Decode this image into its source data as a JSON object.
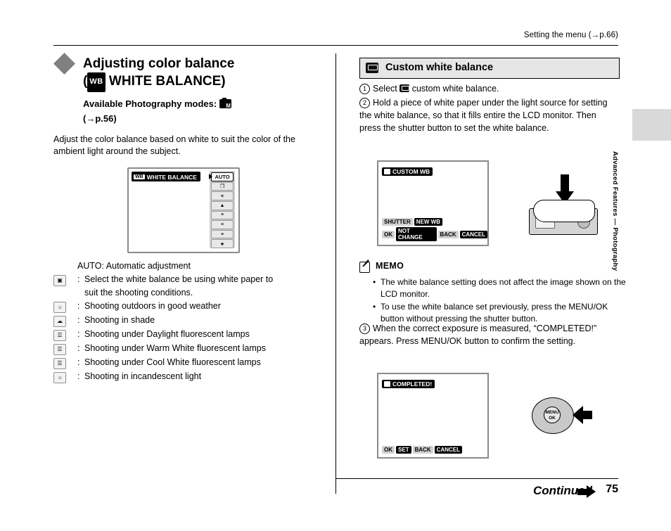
{
  "header": {
    "running_head": "Setting the menu (→p.66)"
  },
  "side_tab": {
    "label": "Advanced Features — Photography"
  },
  "left": {
    "title_line1": "Adjusting color balance",
    "title_line2_prefix": "(",
    "title_wb_chip": "WB",
    "title_line2_suffix": " WHITE BALANCE)",
    "modes_label": "Available Photography modes:",
    "modes_page": "(→p.56)",
    "intro": "Adjust the color balance based on white to suit the color of the ambient light around the subject.",
    "lcd": {
      "title": "WHITE BALANCE",
      "title_icon": "WB",
      "selected": "AUTO",
      "items": [
        "AUTO",
        "❐",
        "☀",
        "▲",
        "≡",
        "≡",
        "≡",
        "★"
      ]
    },
    "legend": [
      {
        "glyph": "",
        "label": "AUTO:",
        "text": "Automatic adjustment"
      },
      {
        "glyph": "custom-wb-icon",
        "label": ":",
        "text": "Select the white balance be using white paper to",
        "text2": "suit the shooting conditions."
      },
      {
        "glyph": "sun-icon",
        "label": ":",
        "text": "Shooting outdoors in good weather"
      },
      {
        "glyph": "shade-icon",
        "label": ":",
        "text": "Shooting in shade"
      },
      {
        "glyph": "daylight-fluorescent-icon",
        "label": ":",
        "text": "Shooting under Daylight fluorescent lamps"
      },
      {
        "glyph": "warm-white-fluorescent-icon",
        "label": ":",
        "text": "Shooting under Warm White fluorescent lamps"
      },
      {
        "glyph": "cool-white-fluorescent-icon",
        "label": ":",
        "text": "Shooting under Cool White fluorescent lamps"
      },
      {
        "glyph": "incandescent-icon",
        "label": ":",
        "text": "Shooting in incandescent light"
      }
    ]
  },
  "right": {
    "section_title": "Custom white balance",
    "steps": [
      {
        "num": "1",
        "text_before": "Select ",
        "text_after": " custom white balance."
      },
      {
        "num": "2",
        "text": "Hold a piece of white paper under the light source for setting the white balance, so that it fills entire the LCD monitor. Then press the shutter button to set the white balance."
      },
      {
        "num": "3",
        "text": "When the correct exposure is measured, “COMPLETED!” appears. Press MENU/OK button to confirm the setting."
      }
    ],
    "lcd2": {
      "title": "CUSTOM WB",
      "btn_shutter": "SHUTTER",
      "btn_shutter_action": "NEW WB",
      "btn_ok": "OK",
      "btn_ok_action": "NOT CHANGE",
      "btn_back": "BACK",
      "btn_back_action": "CANCEL"
    },
    "lcd3": {
      "title": "COMPLETED!",
      "btn_ok": "OK",
      "btn_ok_action": "SET",
      "btn_back": "BACK",
      "btn_back_action": "CANCEL"
    },
    "dial": {
      "label_line1": "MENU",
      "label_line2": "OK"
    },
    "memo": {
      "title": "MEMO",
      "items": [
        "The white balance setting does not affect the image shown on the LCD monitor.",
        "To use the white balance set previously, press the MENU/OK button without pressing the shutter button."
      ]
    }
  },
  "footer": {
    "continued": "Continued",
    "page_number": "75"
  }
}
